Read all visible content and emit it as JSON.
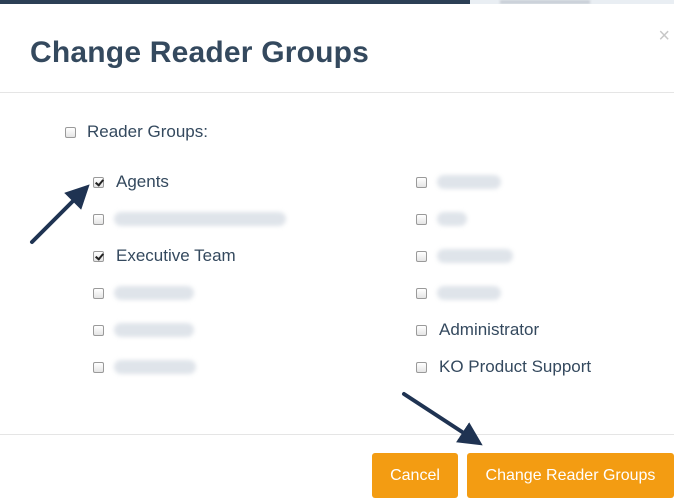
{
  "modal": {
    "title": "Change Reader Groups",
    "close_label": "×"
  },
  "groups": {
    "header_label": "Reader Groups:",
    "header_checked": false,
    "left_column": [
      {
        "label": "Agents",
        "checked": true,
        "blurred": false
      },
      {
        "label": "",
        "checked": false,
        "blurred": true
      },
      {
        "label": "Executive Team",
        "checked": true,
        "blurred": false
      },
      {
        "label": "",
        "checked": false,
        "blurred": true
      },
      {
        "label": "",
        "checked": false,
        "blurred": true
      },
      {
        "label": "",
        "checked": false,
        "blurred": true
      }
    ],
    "right_column": [
      {
        "label": "",
        "checked": false,
        "blurred": true
      },
      {
        "label": "",
        "checked": false,
        "blurred": true
      },
      {
        "label": "",
        "checked": false,
        "blurred": true
      },
      {
        "label": "",
        "checked": false,
        "blurred": true
      },
      {
        "label": "Administrator",
        "checked": false,
        "blurred": false
      },
      {
        "label": "KO Product Support",
        "checked": false,
        "blurred": false
      }
    ]
  },
  "footer": {
    "cancel_label": "Cancel",
    "submit_label": "Change Reader Groups"
  },
  "colors": {
    "button": "#f39c12",
    "title": "#34495e",
    "arrow": "#1f3352"
  }
}
